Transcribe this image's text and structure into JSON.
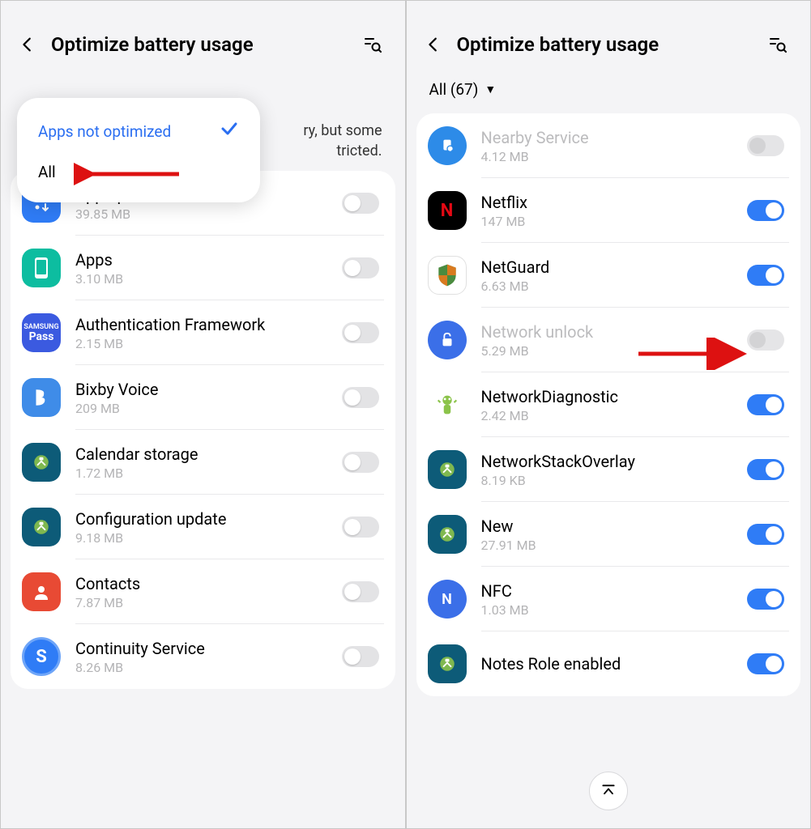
{
  "left": {
    "header": {
      "title": "Optimize battery usage"
    },
    "hint_visible_tail1": "ry, but some",
    "hint_visible_tail2": "tricted.",
    "dropdown": {
      "selected": "Apps not optimized",
      "other": "All"
    },
    "apps": [
      {
        "name": "App update",
        "size": "39.85 MB",
        "toggle": "off",
        "disabled": false,
        "icon": "ic-appupdate"
      },
      {
        "name": "Apps",
        "size": "3.10 MB",
        "toggle": "off",
        "disabled": false,
        "icon": "ic-apps"
      },
      {
        "name": "Authentication Framework",
        "size": "2.15 MB",
        "toggle": "off",
        "disabled": false,
        "icon": "ic-samsungpass"
      },
      {
        "name": "Bixby Voice",
        "size": "209 MB",
        "toggle": "off",
        "disabled": false,
        "icon": "ic-bixby"
      },
      {
        "name": "Calendar storage",
        "size": "1.72 MB",
        "toggle": "off",
        "disabled": false,
        "icon": "ic-calendar"
      },
      {
        "name": "Configuration update",
        "size": "9.18 MB",
        "toggle": "off",
        "disabled": false,
        "icon": "ic-config"
      },
      {
        "name": "Contacts",
        "size": "7.87 MB",
        "toggle": "off",
        "disabled": false,
        "icon": "ic-contacts"
      },
      {
        "name": "Continuity Service",
        "size": "8.26 MB",
        "toggle": "off",
        "disabled": false,
        "icon": "ic-continuity"
      }
    ]
  },
  "right": {
    "header": {
      "title": "Optimize battery usage"
    },
    "filter_label": "All (67)",
    "apps": [
      {
        "name": "Nearby Service",
        "size": "4.12 MB",
        "toggle": "disabled",
        "disabled": true,
        "icon": "ic-nearby"
      },
      {
        "name": "Netflix",
        "size": "147 MB",
        "toggle": "on",
        "disabled": false,
        "icon": "ic-netflix"
      },
      {
        "name": "NetGuard",
        "size": "6.63 MB",
        "toggle": "on",
        "disabled": false,
        "icon": "ic-netguard"
      },
      {
        "name": "Network unlock",
        "size": "5.29 MB",
        "toggle": "disabled",
        "disabled": true,
        "icon": "ic-networkunlock"
      },
      {
        "name": "NetworkDiagnostic",
        "size": "2.42 MB",
        "toggle": "on",
        "disabled": false,
        "icon": "ic-networkdiag"
      },
      {
        "name": "NetworkStackOverlay",
        "size": "8.19 KB",
        "toggle": "on",
        "disabled": false,
        "icon": "ic-networkstack"
      },
      {
        "name": "New",
        "size": "27.91 MB",
        "toggle": "on",
        "disabled": false,
        "icon": "ic-new"
      },
      {
        "name": "NFC",
        "size": "1.03 MB",
        "toggle": "on",
        "disabled": false,
        "icon": "ic-nfc"
      },
      {
        "name": "Notes Role enabled",
        "size": "",
        "toggle": "on",
        "disabled": false,
        "icon": "ic-notesrole"
      }
    ]
  }
}
